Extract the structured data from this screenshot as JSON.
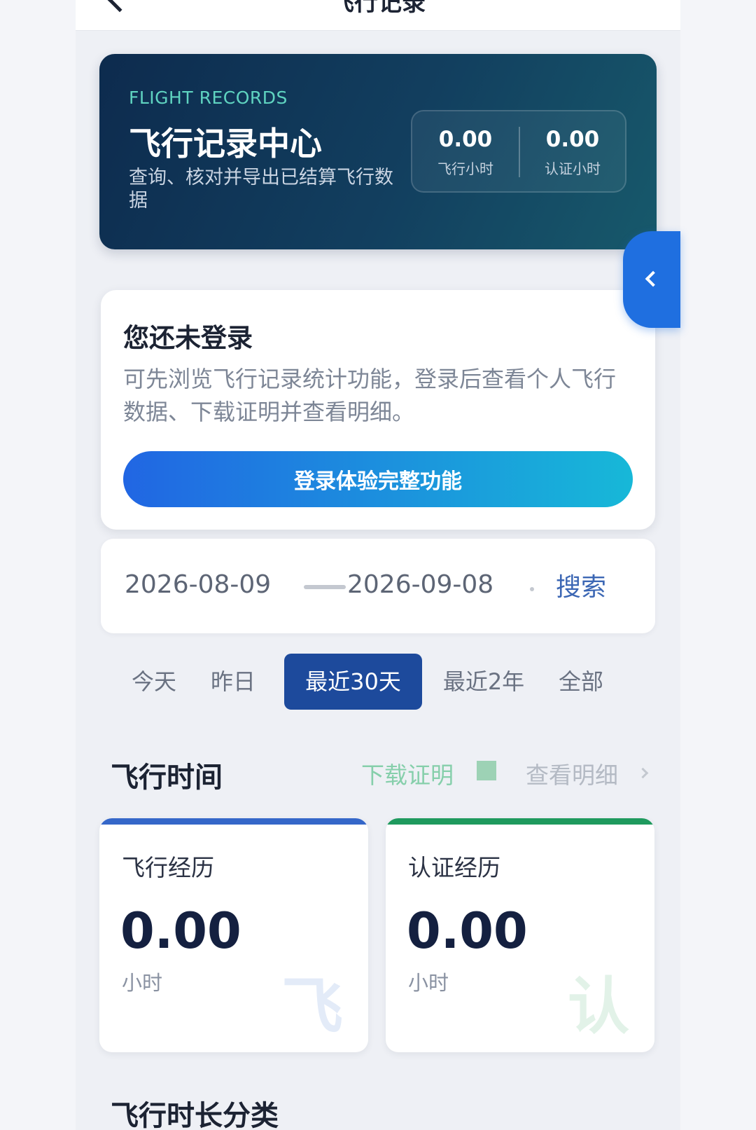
{
  "nav": {
    "title": "飞行记录"
  },
  "hero": {
    "eyebrow": "FLIGHT RECORDS",
    "title": "飞行记录中心",
    "description": "查询、核对并导出已结算飞行数据",
    "stats": [
      {
        "value": "0.00",
        "label": "飞行小时"
      },
      {
        "value": "0.00",
        "label": "认证小时"
      }
    ]
  },
  "login": {
    "title": "您还未登录",
    "description": "可先浏览飞行记录统计功能，登录后查看个人飞行数据、下载证明并查看明细。",
    "button": "登录体验完整功能"
  },
  "date_range": {
    "start": "2026-08-09",
    "end": "2026-09-08",
    "search": "搜索"
  },
  "tabs": [
    {
      "label": "今天"
    },
    {
      "label": "昨日"
    },
    {
      "label": "最近30天",
      "active": true
    },
    {
      "label": "最近2年"
    },
    {
      "label": "全部"
    }
  ],
  "flight_time": {
    "title": "飞行时间",
    "download": "下载证明",
    "detail": "查看明细",
    "cards": [
      {
        "title": "飞行经历",
        "value": "0.00",
        "unit": "小时",
        "watermark": "飞",
        "accent": "#3567c9",
        "watermark_color": "#e3ebf8"
      },
      {
        "title": "认证经历",
        "value": "0.00",
        "unit": "小时",
        "watermark": "认",
        "accent": "#1f9a5e",
        "watermark_color": "#e2f2e8"
      }
    ]
  },
  "category": {
    "title": "飞行时长分类"
  },
  "icons": {
    "nav_back": "chevron-left-icon",
    "side": "chevron-left-icon",
    "detail": "chevron-right-icon"
  }
}
